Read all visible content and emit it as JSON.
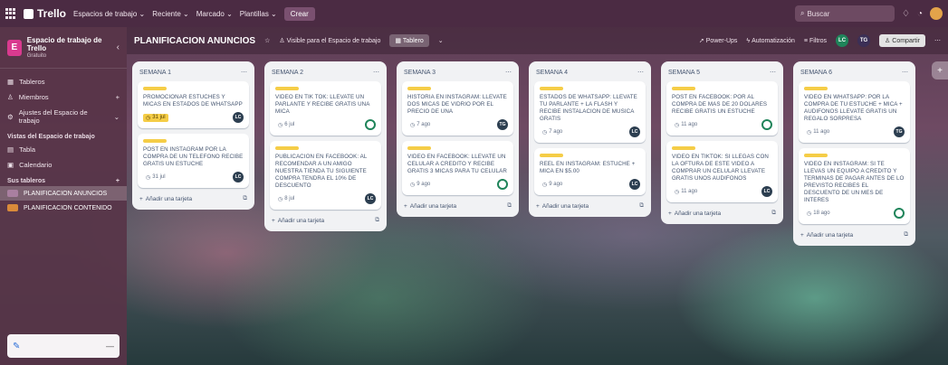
{
  "topbar": {
    "app_name": "Trello",
    "menus": [
      "Espacios de trabajo",
      "Reciente",
      "Marcado",
      "Plantillas"
    ],
    "create_label": "Crear",
    "search_placeholder": "Buscar"
  },
  "sidebar": {
    "workspace_name": "Espacio de trabajo de Trello",
    "workspace_plan": "Gratuito",
    "workspace_initial": "E",
    "items": [
      {
        "label": "Tableros",
        "icon": "board-icon"
      },
      {
        "label": "Miembros",
        "icon": "members-icon"
      },
      {
        "label": "Ajustes del Espacio de trabajo",
        "icon": "gear-icon"
      }
    ],
    "views_section": "Vistas del Espacio de trabajo",
    "views": [
      {
        "label": "Tabla",
        "icon": "table-icon"
      },
      {
        "label": "Calendario",
        "icon": "calendar-icon"
      }
    ],
    "boards_section": "Sus tableros",
    "boards": [
      {
        "label": "PLANIFICACION ANUNCIOS",
        "active": true,
        "color": "#a97fa0"
      },
      {
        "label": "PLANIFICACION CONTENIDO",
        "active": false,
        "color": "#d98a3a"
      }
    ]
  },
  "board_header": {
    "title": "PLANIFICACION ANUNCIOS",
    "visibility": "Visible para el Espacio de trabajo",
    "view_button": "Tablero",
    "power_ups": "Power-Ups",
    "automation": "Automatización",
    "filters": "Filtros",
    "member_initials": "LC",
    "member_initials_2": "TG",
    "share_label": "Compartir"
  },
  "lists": [
    {
      "title": "SEMANA 1",
      "cards": [
        {
          "text": "PROMOCIONAR ESTUCHES Y MICAS EN ESTADOS DE WHATSAPP",
          "date": "31 jul",
          "due": true,
          "member": "LC",
          "member_style": "dark"
        },
        {
          "text": "POST EN INSTAGRAM POR LA COMPRA DE UN TELEFONO RECIBE GRATIS UN ESTUCHE",
          "date": "31 jul",
          "due": false,
          "member": "LC",
          "member_style": "dark"
        }
      ],
      "add_label": "Añadir una tarjeta"
    },
    {
      "title": "SEMANA 2",
      "cards": [
        {
          "text": "VIDEO EN TIK TOK: LLEVATE UN PARLANTE Y RECIBE GRATIS UNA MICA",
          "date": "6 jul",
          "due": false,
          "member": "",
          "member_style": "green"
        },
        {
          "text": "PUBLICACION EN FACEBOOK: AL RECOMENDAR A UN AMIGO NUESTRA TIENDA TU SIGUIENTE COMPRA TENDRA EL 10% DE DESCUENTO",
          "date": "8 jul",
          "due": false,
          "member": "LC",
          "member_style": "dark"
        }
      ],
      "add_label": "Añadir una tarjeta"
    },
    {
      "title": "SEMANA 3",
      "cards": [
        {
          "text": "HISTORIA EN INSTAGRAM: LLEVATE DOS MICAS DE VIDRIO POR EL PRECIO DE UNA",
          "date": "7 ago",
          "due": false,
          "member": "TG",
          "member_style": "dark"
        },
        {
          "text": "VIDEO EN FACEBOOK: LLEVATE UN CELULAR A CREDITO Y RECIBE GRATIS 3 MICAS PARA TU CELULAR",
          "date": "9 ago",
          "due": false,
          "member": "",
          "member_style": "green"
        }
      ],
      "add_label": "Añadir una tarjeta"
    },
    {
      "title": "SEMANA 4",
      "cards": [
        {
          "text": "ESTADOS DE WHATSAPP: LLEVATE TU PARLANTE + LA FLASH Y RECIBE INSTALACION DE MUSICA GRATIS",
          "date": "7 ago",
          "due": false,
          "member": "LC",
          "member_style": "dark"
        },
        {
          "text": "REEL EN INSTAGRAM: ESTUCHE + MICA EN $5.00",
          "date": "9 ago",
          "due": false,
          "member": "LC",
          "member_style": "dark"
        }
      ],
      "add_label": "Añadir una tarjeta"
    },
    {
      "title": "SEMANA 5",
      "cards": [
        {
          "text": "POST EN FACEBOOK: POR AL COMPRA DE MAS DE 20 DOLARES RECIBE GRATIS UN ESTUCHE",
          "date": "11 ago",
          "due": false,
          "member": "",
          "member_style": "green"
        },
        {
          "text": "VIDEO EN TIKTOK: SI LLEGAS CON LA OFTURA DE ESTE VIDEO A COMPRAR UN CELULAR LLEVATE GRATIS UNOS AUDIFONOS",
          "date": "11 ago",
          "due": false,
          "member": "LC",
          "member_style": "dark"
        }
      ],
      "add_label": "Añadir una tarjeta"
    },
    {
      "title": "SEMANA 6",
      "cards": [
        {
          "text": "VIDEO EN WHATSAPP: POR LA COMPRA DE TU ESTUCHE + MICA + AUDIFONOS LLEVATE GRATIS UN REGALO SORPRESA",
          "date": "11 ago",
          "due": false,
          "member": "TG",
          "member_style": "dark"
        },
        {
          "text": "VIDEO EN INSTAGRAM: SI TE LLEVAS UN EQUIPO A CREDITO Y TERMINAS DE PAGAR ANTES DE LO PREVISTO RECIBES EL DESCUENTO DE UN MES DE INTERES",
          "date": "18 ago",
          "due": false,
          "member": "",
          "member_style": "green"
        }
      ],
      "add_label": "Añadir una tarjeta"
    }
  ],
  "colors": {
    "topbar": "#4b2b43",
    "sidebar": "#583448",
    "list_bg": "#f1f2f4",
    "label_yellow": "#f5cd47",
    "member_green": "#1f845a"
  }
}
